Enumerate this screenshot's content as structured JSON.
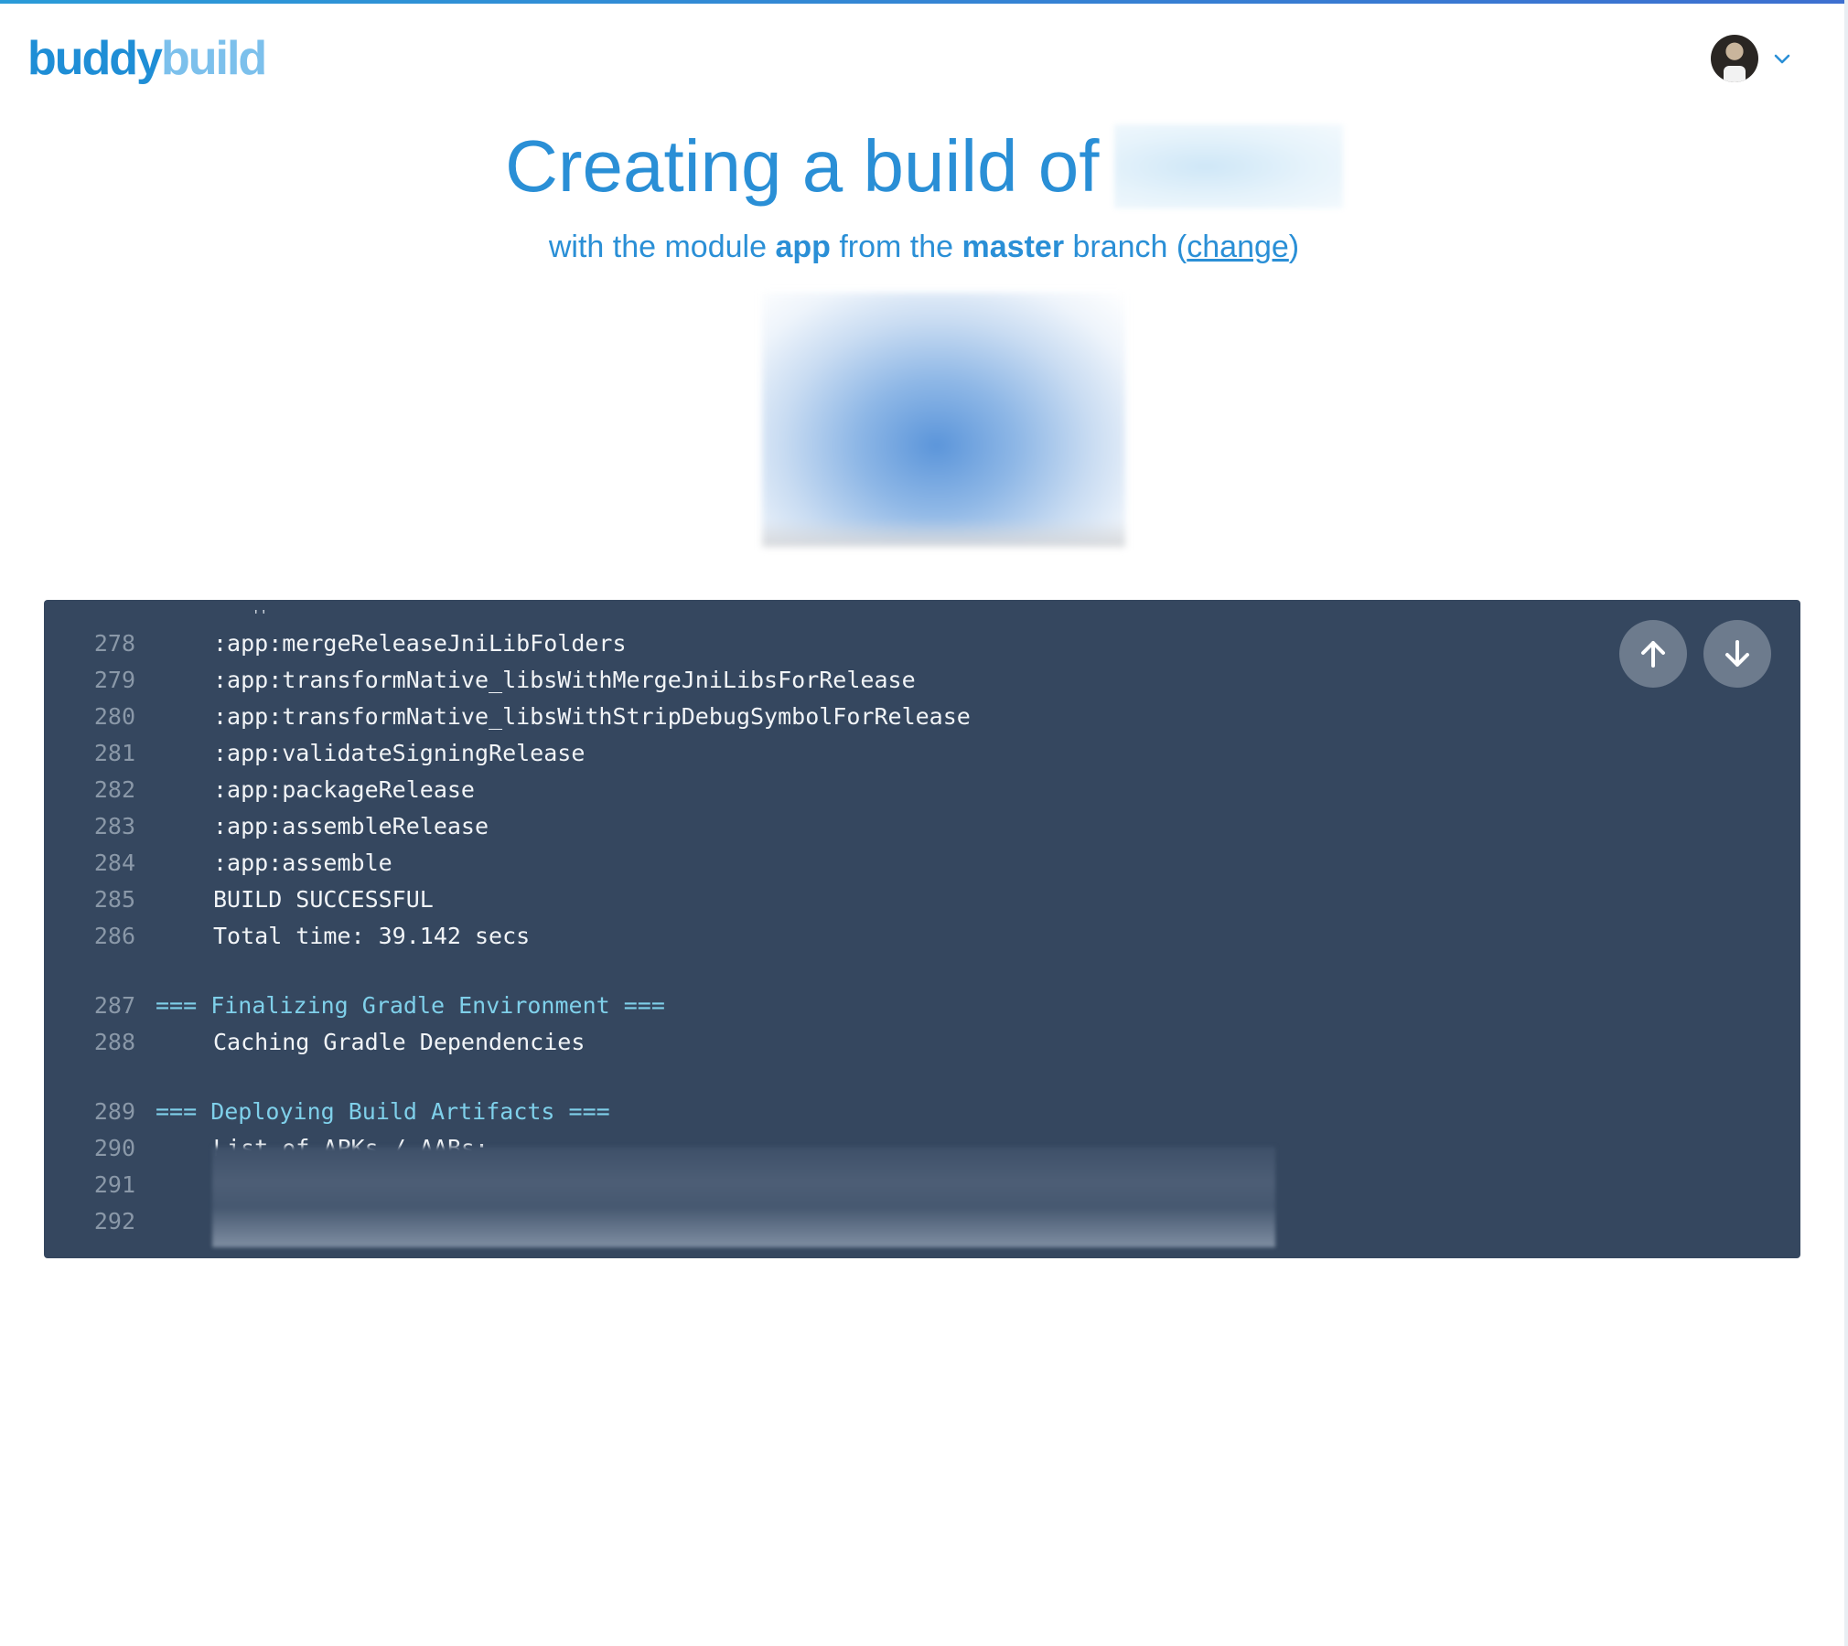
{
  "brand": {
    "logo_part1": "buddy",
    "logo_part2": "build",
    "primary_color": "#2a8fd6",
    "log_bg_color": "#35475f"
  },
  "header": {
    "avatar_icon": "user-avatar",
    "menu_icon": "chevron-down-icon"
  },
  "page": {
    "title": "Creating a build of",
    "subtitle": {
      "prefix": "with the module",
      "module": "app",
      "middle": "from the",
      "branch": "master",
      "suffix": "branch",
      "open_paren": "(",
      "change_link": "change",
      "close_paren": ")"
    }
  },
  "log": {
    "partial_top": "' '",
    "lines": [
      {
        "num": "278",
        "text": ":app:mergeReleaseJniLibFolders",
        "section": false
      },
      {
        "num": "279",
        "text": ":app:transformNative_libsWithMergeJniLibsForRelease",
        "section": false
      },
      {
        "num": "280",
        "text": ":app:transformNative_libsWithStripDebugSymbolForRelease",
        "section": false
      },
      {
        "num": "281",
        "text": ":app:validateSigningRelease",
        "section": false
      },
      {
        "num": "282",
        "text": ":app:packageRelease",
        "section": false
      },
      {
        "num": "283",
        "text": ":app:assembleRelease",
        "section": false
      },
      {
        "num": "284",
        "text": ":app:assemble",
        "section": false
      },
      {
        "num": "285",
        "text": "BUILD SUCCESSFUL",
        "section": false
      },
      {
        "num": "286",
        "text": "Total time: 39.142 secs",
        "section": false
      },
      {
        "num": "287",
        "text": "=== Finalizing Gradle Environment ===",
        "section": true
      },
      {
        "num": "288",
        "text": "Caching Gradle Dependencies",
        "section": false
      },
      {
        "num": "289",
        "text": "=== Deploying Build Artifacts ===",
        "section": true
      },
      {
        "num": "290",
        "text": "List of APKs / AABs:",
        "section": false
      },
      {
        "num": "291",
        "text": "",
        "section": false
      },
      {
        "num": "292",
        "text": "",
        "section": false
      }
    ],
    "scroll_up_icon": "arrow-up-icon",
    "scroll_down_icon": "arrow-down-icon"
  }
}
